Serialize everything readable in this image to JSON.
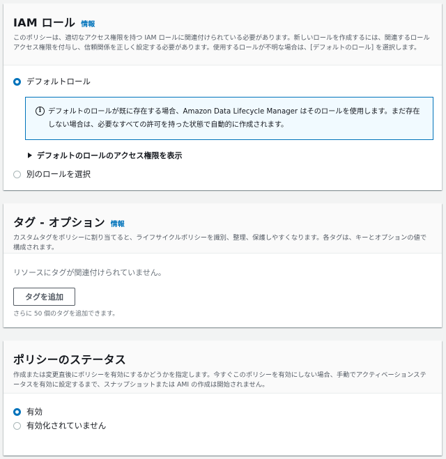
{
  "iam_role": {
    "title": "IAM ロール",
    "info": "情報",
    "description": "このポリシーは、適切なアクセス権限を持つ IAM ロールに関連付けられている必要があります。新しいロールを作成するには、関連するロールアクセス権限を付与し、信頼関係を正しく設定する必要があります。使用するロールが不明な場合は、[デフォルトのロール] を選択します。",
    "option_default": "デフォルトロール",
    "alert_text": "デフォルトのロールが既に存在する場合、Amazon Data Lifecycle Manager はそのロールを使用します。まだ存在しない場合は、必要なすべての許可を持った状態で自動的に作成されます。",
    "expander_label": "デフォルトのロールのアクセス権限を表示",
    "option_other": "別のロールを選択",
    "selected": "default"
  },
  "tags": {
    "title": "タグ - オプション",
    "info": "情報",
    "description": "カスタムタグをポリシーに割り当てると、ライフサイクルポリシーを識別、整理、保護しやすくなります。各タグは、キーとオプションの値で構成されます。",
    "empty_text": "リソースにタグが関連付けられていません。",
    "add_button": "タグを追加",
    "hint": "さらに 50 個のタグを追加できます。"
  },
  "policy_status": {
    "title": "ポリシーのステータス",
    "description": "作成または変更直後にポリシーを有効にするかどうかを指定します。今すぐこのポリシーを有効にしない場合、手動でアクティベーションステータスを有効に設定するまで、スナップショットまたは AMI の作成は開始されません。",
    "option_enabled": "有効",
    "option_disabled": "有効化されていません",
    "selected": "enabled"
  },
  "colors": {
    "accent": "#0073bb",
    "alert_bg": "#f1faff",
    "background": "#f2f3f3"
  }
}
